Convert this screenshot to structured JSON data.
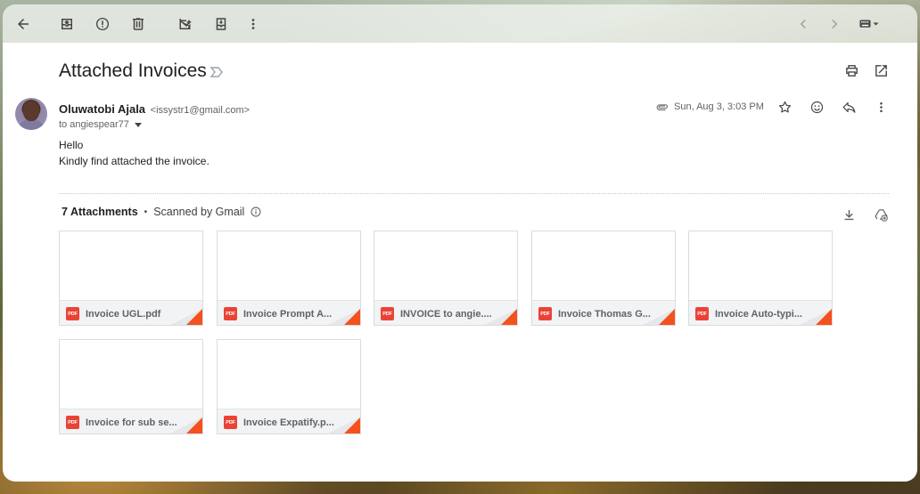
{
  "toolbar": {
    "icons": [
      "back-arrow-icon",
      "archive-icon",
      "report-spam-icon",
      "delete-icon",
      "mark-unread-icon",
      "move-to-icon",
      "more-vert-icon",
      "chevron-left-icon",
      "chevron-right-icon",
      "keyboard-icon"
    ]
  },
  "email": {
    "subject": "Attached Invoices",
    "sender_name": "Oluwatobi Ajala",
    "sender_email": "<issystr1@gmail.com>",
    "to": "to angiespear77",
    "date": "Sun, Aug 3, 3:03 PM",
    "body_line1": "Hello",
    "body_line2": "Kindly find attached the invoice."
  },
  "attachments": {
    "count_label": "7 Attachments",
    "separator": "•",
    "scanned_label": "Scanned by Gmail",
    "type_badge": "PDF",
    "items": [
      {
        "name": "Invoice UGL.pdf"
      },
      {
        "name": "Invoice Prompt A..."
      },
      {
        "name": "INVOICE to angie...."
      },
      {
        "name": "Invoice Thomas G..."
      },
      {
        "name": "Invoice Auto-typi..."
      },
      {
        "name": "Invoice for sub se..."
      },
      {
        "name": "Invoice Expatify.p..."
      }
    ]
  },
  "colors": {
    "pdf_red": "#ea4335",
    "corner_orange": "#f4511e"
  }
}
